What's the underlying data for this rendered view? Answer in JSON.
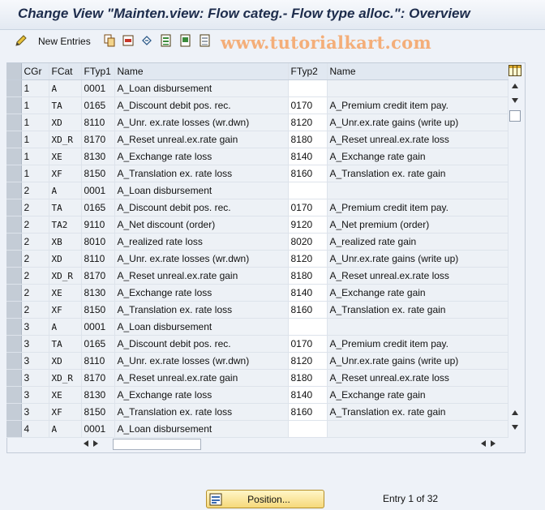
{
  "window": {
    "title": "Change View \"Mainten.view: Flow categ.- Flow type alloc.\": Overview"
  },
  "toolbar": {
    "new_entries_label": "New Entries"
  },
  "watermark": "www.tutorialkart.com",
  "table": {
    "columns": {
      "cgr": "CGr",
      "fcat": "FCat",
      "ftyp1": "FTyp1",
      "name1": "Name",
      "ftyp2": "FTyp2",
      "name2": "Name"
    },
    "rows": [
      {
        "cgr": "1",
        "fcat": "A",
        "ftyp1": "0001",
        "name1": "A_Loan disbursement",
        "ftyp2": "",
        "name2": ""
      },
      {
        "cgr": "1",
        "fcat": "TA",
        "ftyp1": "0165",
        "name1": "A_Discount debit pos. rec.",
        "ftyp2": "0170",
        "name2": "A_Premium credit item pay."
      },
      {
        "cgr": "1",
        "fcat": "XD",
        "ftyp1": "8110",
        "name1": "A_Unr. ex.rate losses (wr.dwn)",
        "ftyp2": "8120",
        "name2": "A_Unr.ex.rate gains (write up)"
      },
      {
        "cgr": "1",
        "fcat": "XD_R",
        "ftyp1": "8170",
        "name1": "A_Reset unreal.ex.rate gain",
        "ftyp2": "8180",
        "name2": "A_Reset unreal.ex.rate loss"
      },
      {
        "cgr": "1",
        "fcat": "XE",
        "ftyp1": "8130",
        "name1": "A_Exchange rate loss",
        "ftyp2": "8140",
        "name2": "A_Exchange rate gain"
      },
      {
        "cgr": "1",
        "fcat": "XF",
        "ftyp1": "8150",
        "name1": "A_Translation ex. rate loss",
        "ftyp2": "8160",
        "name2": "A_Translation ex. rate gain"
      },
      {
        "cgr": "2",
        "fcat": "A",
        "ftyp1": "0001",
        "name1": "A_Loan disbursement",
        "ftyp2": "",
        "name2": ""
      },
      {
        "cgr": "2",
        "fcat": "TA",
        "ftyp1": "0165",
        "name1": "A_Discount debit pos. rec.",
        "ftyp2": "0170",
        "name2": "A_Premium credit item pay."
      },
      {
        "cgr": "2",
        "fcat": "TA2",
        "ftyp1": "9110",
        "name1": "A_Net discount (order)",
        "ftyp2": "9120",
        "name2": "A_Net premium (order)"
      },
      {
        "cgr": "2",
        "fcat": "XB",
        "ftyp1": "8010",
        "name1": "A_realized rate loss",
        "ftyp2": "8020",
        "name2": "A_realized rate gain"
      },
      {
        "cgr": "2",
        "fcat": "XD",
        "ftyp1": "8110",
        "name1": "A_Unr. ex.rate losses (wr.dwn)",
        "ftyp2": "8120",
        "name2": "A_Unr.ex.rate gains (write up)"
      },
      {
        "cgr": "2",
        "fcat": "XD_R",
        "ftyp1": "8170",
        "name1": "A_Reset unreal.ex.rate gain",
        "ftyp2": "8180",
        "name2": "A_Reset unreal.ex.rate loss"
      },
      {
        "cgr": "2",
        "fcat": "XE",
        "ftyp1": "8130",
        "name1": "A_Exchange rate loss",
        "ftyp2": "8140",
        "name2": "A_Exchange rate gain"
      },
      {
        "cgr": "2",
        "fcat": "XF",
        "ftyp1": "8150",
        "name1": "A_Translation ex. rate loss",
        "ftyp2": "8160",
        "name2": "A_Translation ex. rate gain"
      },
      {
        "cgr": "3",
        "fcat": "A",
        "ftyp1": "0001",
        "name1": "A_Loan disbursement",
        "ftyp2": "",
        "name2": ""
      },
      {
        "cgr": "3",
        "fcat": "TA",
        "ftyp1": "0165",
        "name1": "A_Discount debit pos. rec.",
        "ftyp2": "0170",
        "name2": "A_Premium credit item pay."
      },
      {
        "cgr": "3",
        "fcat": "XD",
        "ftyp1": "8110",
        "name1": "A_Unr. ex.rate losses (wr.dwn)",
        "ftyp2": "8120",
        "name2": "A_Unr.ex.rate gains (write up)"
      },
      {
        "cgr": "3",
        "fcat": "XD_R",
        "ftyp1": "8170",
        "name1": "A_Reset unreal.ex.rate gain",
        "ftyp2": "8180",
        "name2": "A_Reset unreal.ex.rate loss"
      },
      {
        "cgr": "3",
        "fcat": "XE",
        "ftyp1": "8130",
        "name1": "A_Exchange rate loss",
        "ftyp2": "8140",
        "name2": "A_Exchange rate gain"
      },
      {
        "cgr": "3",
        "fcat": "XF",
        "ftyp1": "8150",
        "name1": "A_Translation ex. rate loss",
        "ftyp2": "8160",
        "name2": "A_Translation ex. rate gain"
      },
      {
        "cgr": "4",
        "fcat": "A",
        "ftyp1": "0001",
        "name1": "A_Loan disbursement",
        "ftyp2": "",
        "name2": ""
      }
    ]
  },
  "footer": {
    "position_button_label": "Position...",
    "entry_text": "Entry 1 of 32"
  },
  "colors": {
    "title": "#1d2c4c",
    "watermark": "#f4ae79",
    "row_selector": "#c4ccd6",
    "position_button": "#f6d97a"
  }
}
